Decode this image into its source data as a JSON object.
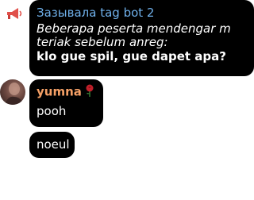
{
  "messages": [
    {
      "sender": "Зазывала tag bot 2",
      "italic_text": "Beberapa peserta mendengar m teriak sebelum anreg:",
      "bold_text": "klo gue spil, gue dapet apa?"
    },
    {
      "sender": "yumna",
      "text": "pooh"
    },
    {
      "text": "noeul"
    }
  ],
  "colors": {
    "bubble": "#000000",
    "bot_name": "#6fb0ea",
    "user_name": "#f5a066"
  }
}
